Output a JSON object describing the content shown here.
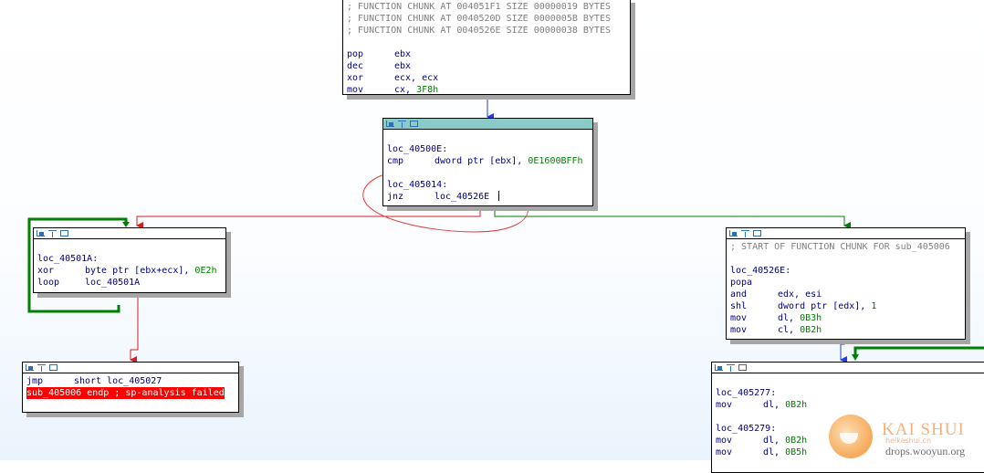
{
  "top_block": {
    "lines": [
      {
        "text": "; FUNCTION CHUNK AT 004051F1 SIZE 00000019 BYTES",
        "kind": "cmt"
      },
      {
        "text": "; FUNCTION CHUNK AT 0040520D SIZE 0000005B BYTES",
        "kind": "cmt"
      },
      {
        "text": "; FUNCTION CHUNK AT 0040526E SIZE 00000038 BYTES",
        "kind": "cmt"
      },
      {
        "blank": true
      },
      {
        "mn": "pop",
        "op": "ebx"
      },
      {
        "mn": "dec",
        "op": "ebx"
      },
      {
        "mn": "xor",
        "op": "ecx, ecx"
      },
      {
        "mn": "mov",
        "op": "cx, ",
        "num": "3F8h"
      }
    ]
  },
  "loc_40500E_block": {
    "lines": [
      {
        "blank": true
      },
      {
        "label": "loc_40500E:"
      },
      {
        "mn": "cmp",
        "op": "dword ptr [ebx], ",
        "num": "0E1600BFFh"
      },
      {
        "blank": true
      },
      {
        "label": "loc_405014:"
      },
      {
        "mn": "jnz",
        "op": "loc_40526E",
        "cursor": true
      }
    ]
  },
  "loc_40501A_block": {
    "lines": [
      {
        "blank": true
      },
      {
        "label": "loc_40501A:"
      },
      {
        "mn": "xor",
        "op": "byte ptr [ebx+ecx], ",
        "num": "0E2h"
      },
      {
        "mn": "loop",
        "op": "loc_40501A"
      }
    ]
  },
  "jmp_block": {
    "lines": [
      {
        "mn": "jmp",
        "op": "short loc_405027"
      },
      {
        "text": "sub_405006 endp ; sp-analysis failed",
        "kind": "hl"
      }
    ]
  },
  "loc_40526E_block": {
    "lines": [
      {
        "text": "; START OF FUNCTION CHUNK FOR sub_405006",
        "kind": "cmt"
      },
      {
        "blank": true
      },
      {
        "label": "loc_40526E:"
      },
      {
        "mn": "popa",
        "op": ""
      },
      {
        "mn": "and",
        "op": "edx, esi"
      },
      {
        "mn": "shl",
        "op": "dword ptr [edx], ",
        "num": "1"
      },
      {
        "mn": "mov",
        "op": "dl, ",
        "num": "0B3h"
      },
      {
        "mn": "mov",
        "op": "cl, ",
        "num": "0B2h"
      }
    ]
  },
  "loc_405277_block": {
    "lines": [
      {
        "blank": true
      },
      {
        "label": "loc_405277:"
      },
      {
        "mn": "mov",
        "op": "dl, ",
        "num": "0B2h"
      },
      {
        "blank": true
      },
      {
        "label": "loc_405279:"
      },
      {
        "mn": "mov",
        "op": "dl, ",
        "num": "0B2h"
      },
      {
        "mn": "mov",
        "op": "dl, ",
        "num": "0B5h"
      }
    ]
  },
  "colors": {
    "true_edge": "#008000",
    "false_edge": "#d42020",
    "flow_edge": "#1f3fd8",
    "annotation": "#e04040"
  },
  "watermark": {
    "brand": "KAI SHUI",
    "sub": "heikeshui.cn",
    "site": "drops.wooyun.org"
  }
}
